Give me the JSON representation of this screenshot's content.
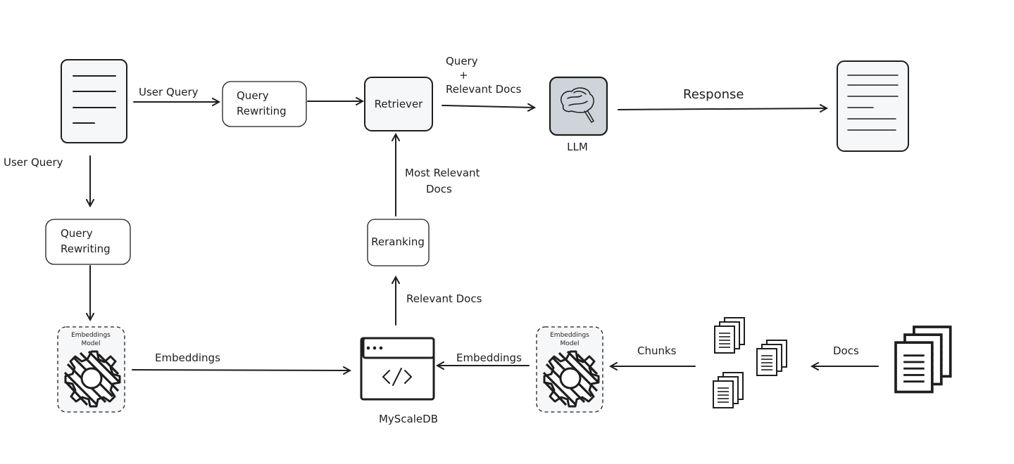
{
  "nodes": {
    "query_rewriting_top": "Query\nRewriting",
    "query_rewriting_top_l1": "Query",
    "query_rewriting_top_l2": "Rewriting",
    "retriever": "Retriever",
    "llm": "LLM",
    "query_rewriting_left_l1": "Query",
    "query_rewriting_left_l2": "Rewriting",
    "reranking": "Reranking",
    "embeddings_model_l1": "Embeddings",
    "embeddings_model_l2": "Model",
    "myscaledb": "MyScaleDB"
  },
  "edges": {
    "user_query_top": "User Query",
    "user_query_left": "User Query",
    "query_plus_docs_l1": "Query",
    "query_plus_docs_l2": "+",
    "query_plus_docs_l3": "Relevant Docs",
    "response": "Response",
    "most_relevant_l1": "Most Relevant",
    "most_relevant_l2": "Docs",
    "relevant_docs": "Relevant Docs",
    "embeddings_left": "Embeddings",
    "embeddings_right": "Embeddings",
    "chunks": "Chunks",
    "docs": "Docs"
  },
  "icons": [
    "document-icon",
    "brain-icon",
    "gear-icon",
    "code-window-icon",
    "document-stack-icon"
  ],
  "colors": {
    "stroke": "#1e1e1e",
    "llm_fill": "#cfd4da",
    "node_fill": "#f6f7f9"
  }
}
